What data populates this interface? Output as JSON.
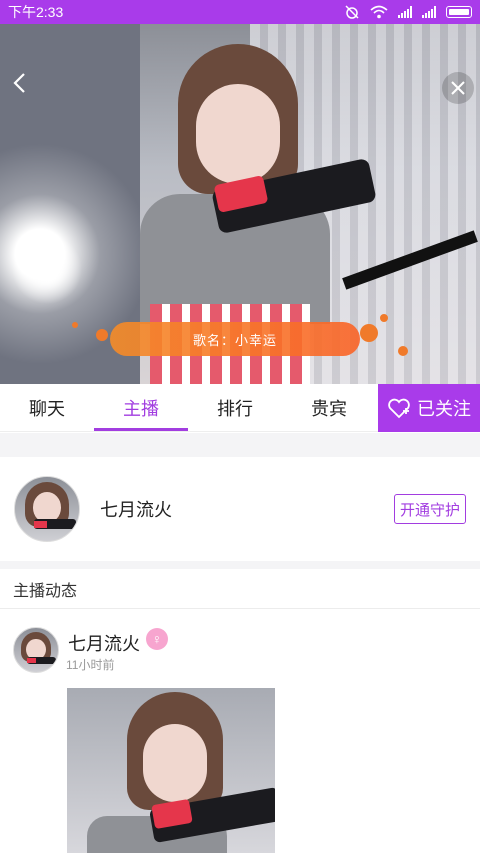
{
  "status_bar": {
    "time": "下午2:33"
  },
  "live": {
    "song_label": "歌名：小幸运"
  },
  "tabs": [
    {
      "label": "聊天",
      "active": false
    },
    {
      "label": "主播",
      "active": true
    },
    {
      "label": "排行",
      "active": false
    },
    {
      "label": "贵宾",
      "active": false
    }
  ],
  "follow_button": {
    "label": "已关注"
  },
  "host": {
    "name": "七月流火",
    "guard_button": "开通守护"
  },
  "feed": {
    "section_title": "主播动态",
    "posts": [
      {
        "author": "七月流火",
        "gender_badge": "female",
        "time": "11小时前"
      }
    ]
  },
  "colors": {
    "accent": "#a93bea",
    "tab_active": "#a23de0",
    "song_pill": "#f58c28"
  }
}
